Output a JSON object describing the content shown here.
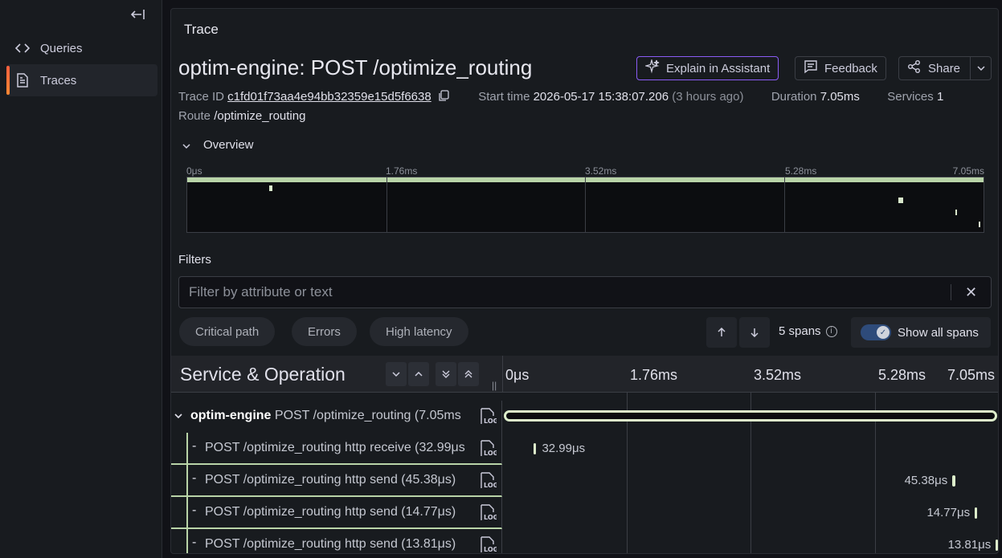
{
  "sidebar": {
    "collapse_icon": "collapse-left-icon",
    "items": [
      {
        "label": "Queries",
        "icon": "code-icon",
        "active": false
      },
      {
        "label": "Traces",
        "icon": "document-icon",
        "active": true
      }
    ]
  },
  "panel": {
    "title": "Trace"
  },
  "trace": {
    "title": "optim-engine: POST /optimize_routing",
    "trace_id_label": "Trace ID",
    "trace_id": "c1fd01f73aa4e94bb32359e15d5f6638",
    "start_time_label": "Start time",
    "start_time": "2026-05-17 15:38:07.206",
    "start_time_relative": "(3 hours ago)",
    "duration_label": "Duration",
    "duration": "7.05ms",
    "services_label": "Services",
    "services": "1",
    "route_label": "Route",
    "route": "/optimize_routing"
  },
  "actions": {
    "assistant": "Explain in Assistant",
    "feedback": "Feedback",
    "share": "Share"
  },
  "overview": {
    "label": "Overview",
    "ticks": [
      "0μs",
      "1.76ms",
      "3.52ms",
      "5.28ms",
      "7.05ms"
    ]
  },
  "filters": {
    "label": "Filters",
    "placeholder": "Filter by attribute or text",
    "chips": [
      "Critical path",
      "Errors",
      "High latency"
    ],
    "span_count": "5 spans",
    "show_all": "Show all spans",
    "show_all_enabled": true
  },
  "table": {
    "column_title": "Service & Operation",
    "ticks": [
      "0μs",
      "1.76ms",
      "3.52ms",
      "5.28ms",
      "7.05ms"
    ],
    "rows": [
      {
        "service": "optim-engine",
        "operation": "POST /optimize_routing (7.05ms",
        "duration": "",
        "start_ms": 0,
        "duration_ms": 7.05
      },
      {
        "service": "",
        "operation": "POST /optimize_routing http receive (32.99μs",
        "duration": "32.99μs",
        "start_ms": 0.43,
        "duration_ms": 0.033
      },
      {
        "service": "",
        "operation": "POST /optimize_routing http send (45.38μs)",
        "duration": "45.38μs",
        "start_ms": 6.41,
        "duration_ms": 0.045
      },
      {
        "service": "",
        "operation": "POST /optimize_routing http send (14.77μs)",
        "duration": "14.77μs",
        "start_ms": 6.73,
        "duration_ms": 0.015
      },
      {
        "service": "",
        "operation": "POST /optimize_routing http send (13.81μs)",
        "duration": "13.81μs",
        "start_ms": 7.03,
        "duration_ms": 0.014
      }
    ]
  }
}
